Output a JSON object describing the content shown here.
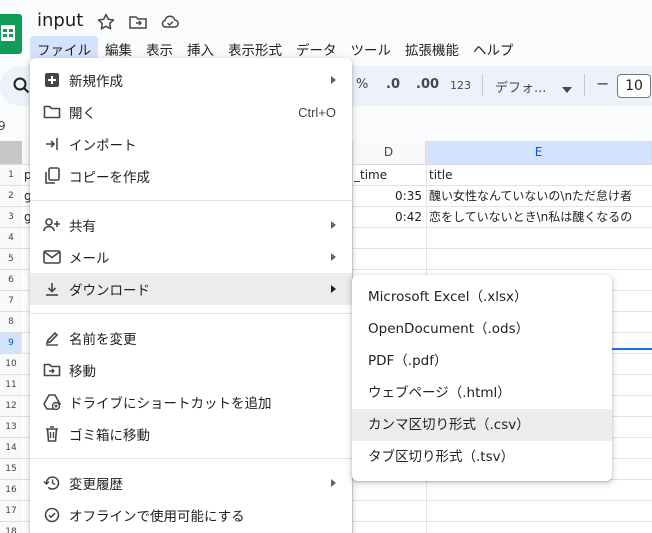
{
  "app": {
    "doc_title": "input",
    "brand_color": "#0f9d58",
    "icons": [
      "sheets-logo",
      "star-icon",
      "move-folder-icon",
      "cloud-status-icon"
    ]
  },
  "menubar": {
    "items": [
      {
        "label": "ファイル",
        "active": true
      },
      {
        "label": "編集"
      },
      {
        "label": "表示"
      },
      {
        "label": "挿入"
      },
      {
        "label": "表示形式"
      },
      {
        "label": "データ"
      },
      {
        "label": "ツール"
      },
      {
        "label": "拡張機能"
      },
      {
        "label": "ヘルプ"
      }
    ]
  },
  "toolbar": {
    "percent": "%",
    "dec_decrease": ".0",
    "dec_increase": ".00",
    "number_format": "123",
    "font_name": "デフォ...",
    "minus": "−",
    "font_size": "10"
  },
  "namebox_fragment": "9",
  "grid": {
    "columns": [
      "D",
      "E"
    ],
    "selected_column": "E",
    "row_numbers": [
      "1",
      "2",
      "3",
      "4",
      "5",
      "6",
      "7",
      "8",
      "9",
      "10",
      "11",
      "12",
      "13",
      "14",
      "15",
      "16",
      "17",
      "18"
    ],
    "selected_row": "9",
    "header_row": {
      "a": "p",
      "d": "_time",
      "e": "title"
    },
    "rows": [
      {
        "a": "g",
        "d": "0:35",
        "e": "醜い女性なんていないの\\nただ怠け者"
      },
      {
        "a": "g",
        "d": "0:42",
        "e": "恋をしていないとき\\n私は醜くなるの"
      }
    ]
  },
  "file_menu": {
    "groups": [
      [
        {
          "label": "新規作成",
          "icon": "new-icon",
          "submenu": true
        },
        {
          "label": "開く",
          "icon": "folder-open-icon",
          "shortcut": "Ctrl+O"
        },
        {
          "label": "インポート",
          "icon": "import-icon"
        },
        {
          "label": "コピーを作成",
          "icon": "copy-icon"
        }
      ],
      [
        {
          "label": "共有",
          "icon": "share-icon",
          "submenu": true
        },
        {
          "label": "メール",
          "icon": "mail-icon",
          "submenu": true
        },
        {
          "label": "ダウンロード",
          "icon": "download-icon",
          "submenu": true,
          "hover": true
        }
      ],
      [
        {
          "label": "名前を変更",
          "icon": "rename-icon"
        },
        {
          "label": "移動",
          "icon": "move-icon"
        },
        {
          "label": "ドライブにショートカットを追加",
          "icon": "drive-shortcut-icon"
        },
        {
          "label": "ゴミ箱に移動",
          "icon": "trash-icon"
        }
      ],
      [
        {
          "label": "変更履歴",
          "icon": "history-icon",
          "submenu": true
        },
        {
          "label": "オフラインで使用可能にする",
          "icon": "offline-icon"
        }
      ]
    ]
  },
  "download_menu": {
    "items": [
      {
        "label": "Microsoft Excel（.xlsx）"
      },
      {
        "label": "OpenDocument（.ods）"
      },
      {
        "label": "PDF（.pdf）"
      },
      {
        "label": "ウェブページ（.html）"
      },
      {
        "label": "カンマ区切り形式（.csv）",
        "hover": true
      },
      {
        "label": "タブ区切り形式（.tsv）"
      }
    ]
  }
}
